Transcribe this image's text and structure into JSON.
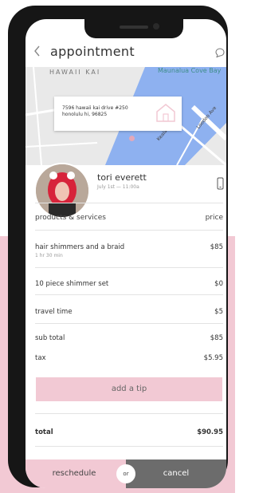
{
  "header": {
    "title": "appointment",
    "back_icon": "chevron-left-icon",
    "chat_icon": "chat-bubble-icon"
  },
  "map": {
    "area_label": "HAWAII KAI",
    "place_label": "Maunalua Cove Bay",
    "address_line1": "7596 hawaii kai drive #250",
    "address_line2": "honolulu hi, 96825",
    "road_labels": [
      "Kealahou Pl",
      "Loodoo Ave"
    ]
  },
  "client": {
    "name": "tori everett",
    "date": "July 1st — 11:00a"
  },
  "services": {
    "header_left": "products & services",
    "header_right": "price",
    "items": [
      {
        "name": "hair shimmers and a braid",
        "sub": "1 hr 30 min",
        "price": "$85"
      },
      {
        "name": "10 piece shimmer set",
        "sub": "",
        "price": "$0"
      },
      {
        "name": "travel time",
        "sub": "",
        "price": "$5"
      }
    ],
    "subtotal_label": "sub total",
    "subtotal": "$85",
    "tax_label": "tax",
    "tax": "$5.95",
    "tip_label": "add a tip",
    "total_label": "total",
    "total": "$90.95"
  },
  "actions": {
    "reschedule": "reschedule",
    "or": "or",
    "cancel": "cancel"
  },
  "colors": {
    "accent_pink": "#f2c9d4",
    "cancel_gray": "#6c6c6c",
    "map_blue": "#8eb1f0"
  }
}
